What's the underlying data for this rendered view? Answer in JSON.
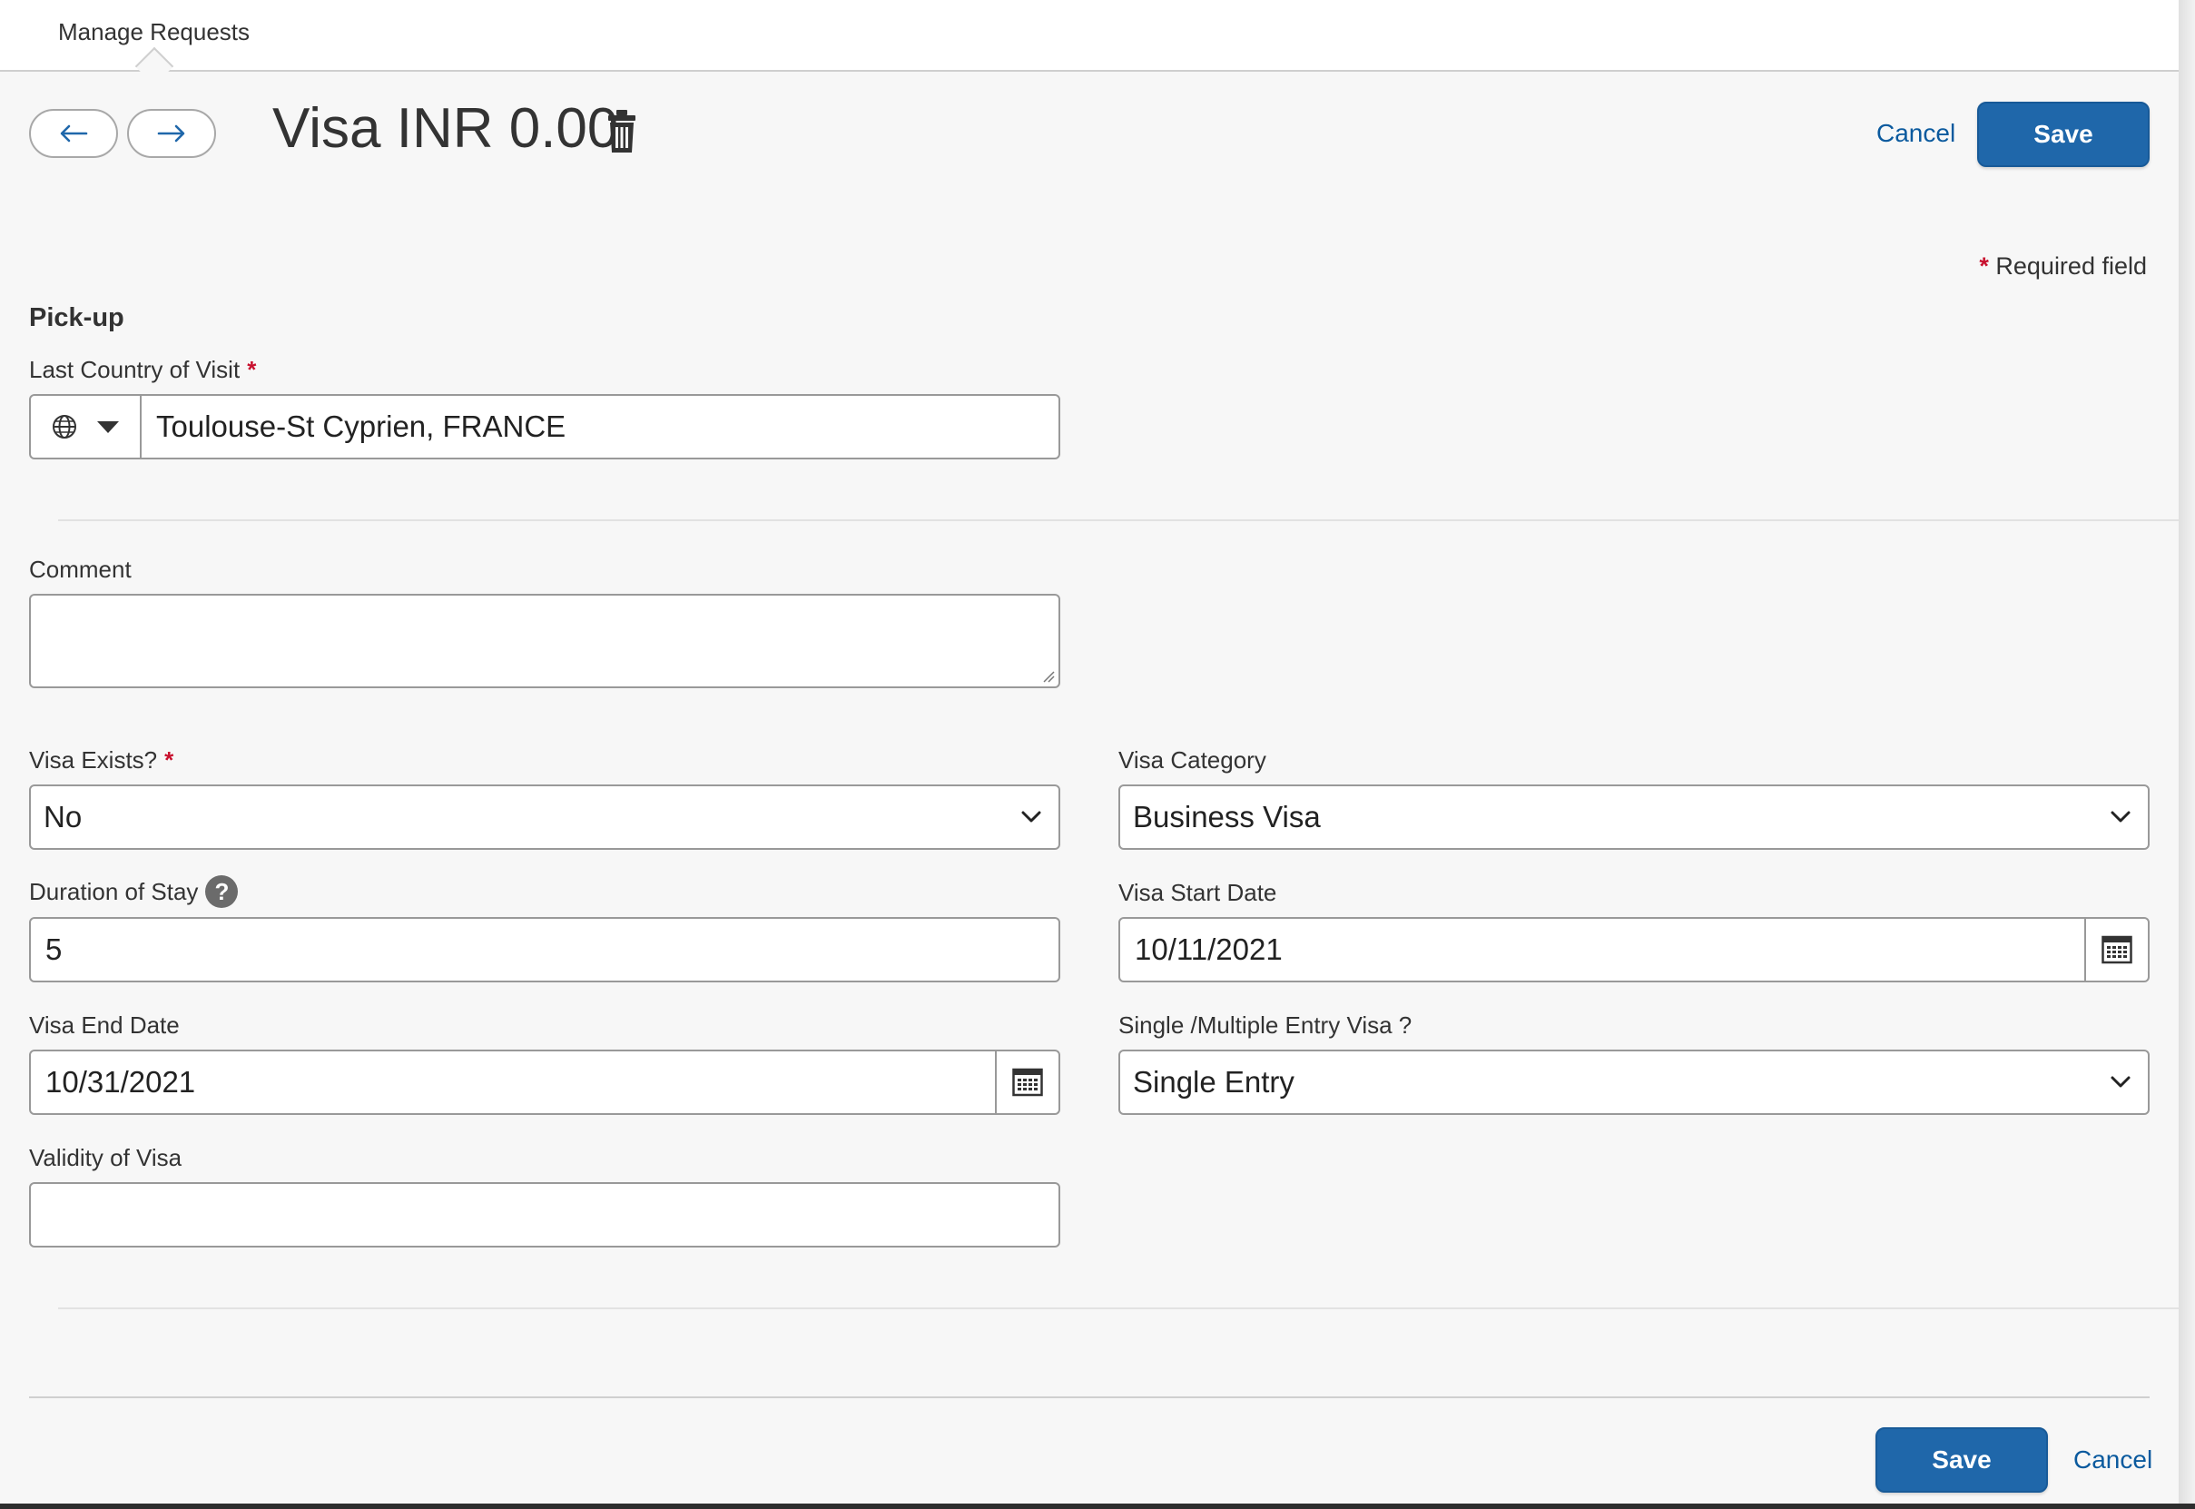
{
  "topbar": {
    "tab_label": "Manage Requests"
  },
  "header": {
    "title": "Visa INR 0.00",
    "cancel_label": "Cancel",
    "save_label": "Save"
  },
  "form": {
    "required_note": "Required field",
    "required_star": "*",
    "section_title": "Pick-up",
    "last_country": {
      "label": "Last Country of Visit",
      "value": "Toulouse-St Cyprien, FRANCE"
    },
    "comment": {
      "label": "Comment",
      "value": ""
    },
    "visa_exists": {
      "label": "Visa Exists?",
      "value": "No"
    },
    "visa_category": {
      "label": "Visa Category",
      "value": "Business Visa"
    },
    "duration_of_stay": {
      "label": "Duration of Stay",
      "value": "5",
      "help_glyph": "?"
    },
    "visa_start_date": {
      "label": "Visa Start Date",
      "value": "10/11/2021"
    },
    "visa_end_date": {
      "label": "Visa End Date",
      "value": "10/31/2021"
    },
    "entry_type": {
      "label": "Single /Multiple Entry Visa ?",
      "value": "Single Entry"
    },
    "validity_of_visa": {
      "label": "Validity of Visa",
      "value": ""
    }
  },
  "footer": {
    "save_label": "Save",
    "cancel_label": "Cancel"
  },
  "colors": {
    "accent": "#1f67aa",
    "link": "#0b5a9e",
    "required": "#c8102e",
    "background": "#f7f7f7"
  },
  "icons": [
    "arrow-left-icon",
    "arrow-right-icon",
    "trash-icon",
    "globe-icon",
    "caret-down-icon",
    "chevron-down-icon",
    "calendar-icon",
    "help-icon"
  ]
}
